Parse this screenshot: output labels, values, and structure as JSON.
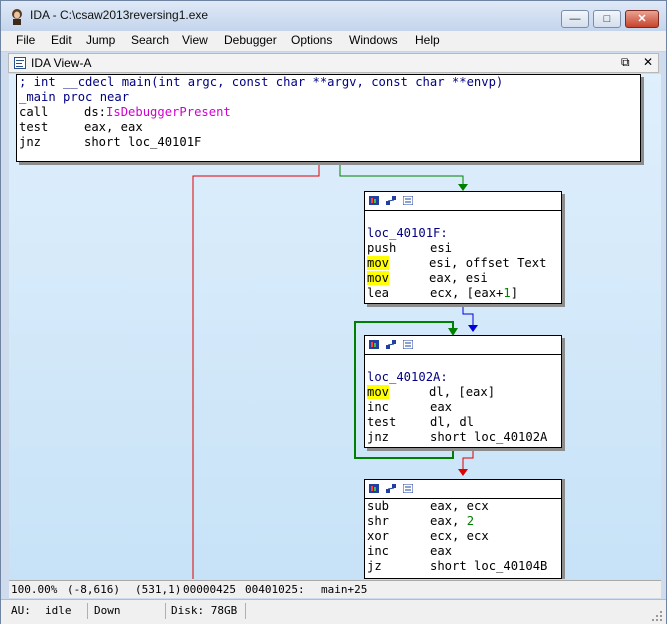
{
  "window": {
    "title": "IDA - C:\\csaw2013reversing1.exe"
  },
  "window_buttons": {
    "minimize": "—",
    "maximize": "□",
    "close": "✕"
  },
  "menu": [
    "File",
    "Edit",
    "Jump",
    "Search",
    "View",
    "Debugger",
    "Options",
    "Windows",
    "Help"
  ],
  "view_tab": {
    "title": "IDA View-A",
    "restore": "⧉",
    "close": "✕"
  },
  "nodes": {
    "entry": {
      "l1": "; int __cdecl main(int argc, const char **argv, const char **envp)",
      "l2": "_main proc near",
      "l3_m": "call",
      "l3_a": "ds:",
      "l3_f": "IsDebuggerPresent",
      "l4_m": "test",
      "l4_a": "eax, eax",
      "l5_m": "jnz",
      "l5_a": "short loc_40101F"
    },
    "n1": {
      "label": "loc_40101F:",
      "r1_m": "push",
      "r1_a": "esi",
      "r2_m": "mov",
      "r2_a": "esi, offset Text",
      "r3_m": "mov",
      "r3_a": "eax, esi",
      "r4_m": "lea",
      "r4_a1": "ecx, [eax+",
      "r4_n": "1",
      "r4_a2": "]"
    },
    "n2": {
      "label": "loc_40102A:",
      "r1_m": "mov",
      "r1_a": "dl, [eax]",
      "r2_m": "inc",
      "r2_a": "eax",
      "r3_m": "test",
      "r3_a": "dl, dl",
      "r4_m": "jnz",
      "r4_a": "short loc_40102A"
    },
    "n3": {
      "r1_m": "sub",
      "r1_a": "eax, ecx",
      "r2_m": "shr",
      "r2_a": "eax, ",
      "r2_n": "2",
      "r3_m": "xor",
      "r3_a": "ecx, ecx",
      "r4_m": "inc",
      "r4_a": "eax",
      "r5_m": "jz",
      "r5_a": "short loc_40104B"
    }
  },
  "status1": {
    "zoom": "100.00%",
    "coords": "(-8,616)",
    "pos": "(531,1)",
    "offset": "00000425",
    "address": "00401025:",
    "symbol": "main+25"
  },
  "status2": {
    "au_label": "AU:",
    "au_value": "idle",
    "direction": "Down",
    "disk": "Disk: 78GB"
  },
  "colors": {
    "edge_true": "#008000",
    "edge_false": "#e00000",
    "edge_next": "#0000e0",
    "highlight": "#ffff00",
    "api": "#d000d0"
  }
}
